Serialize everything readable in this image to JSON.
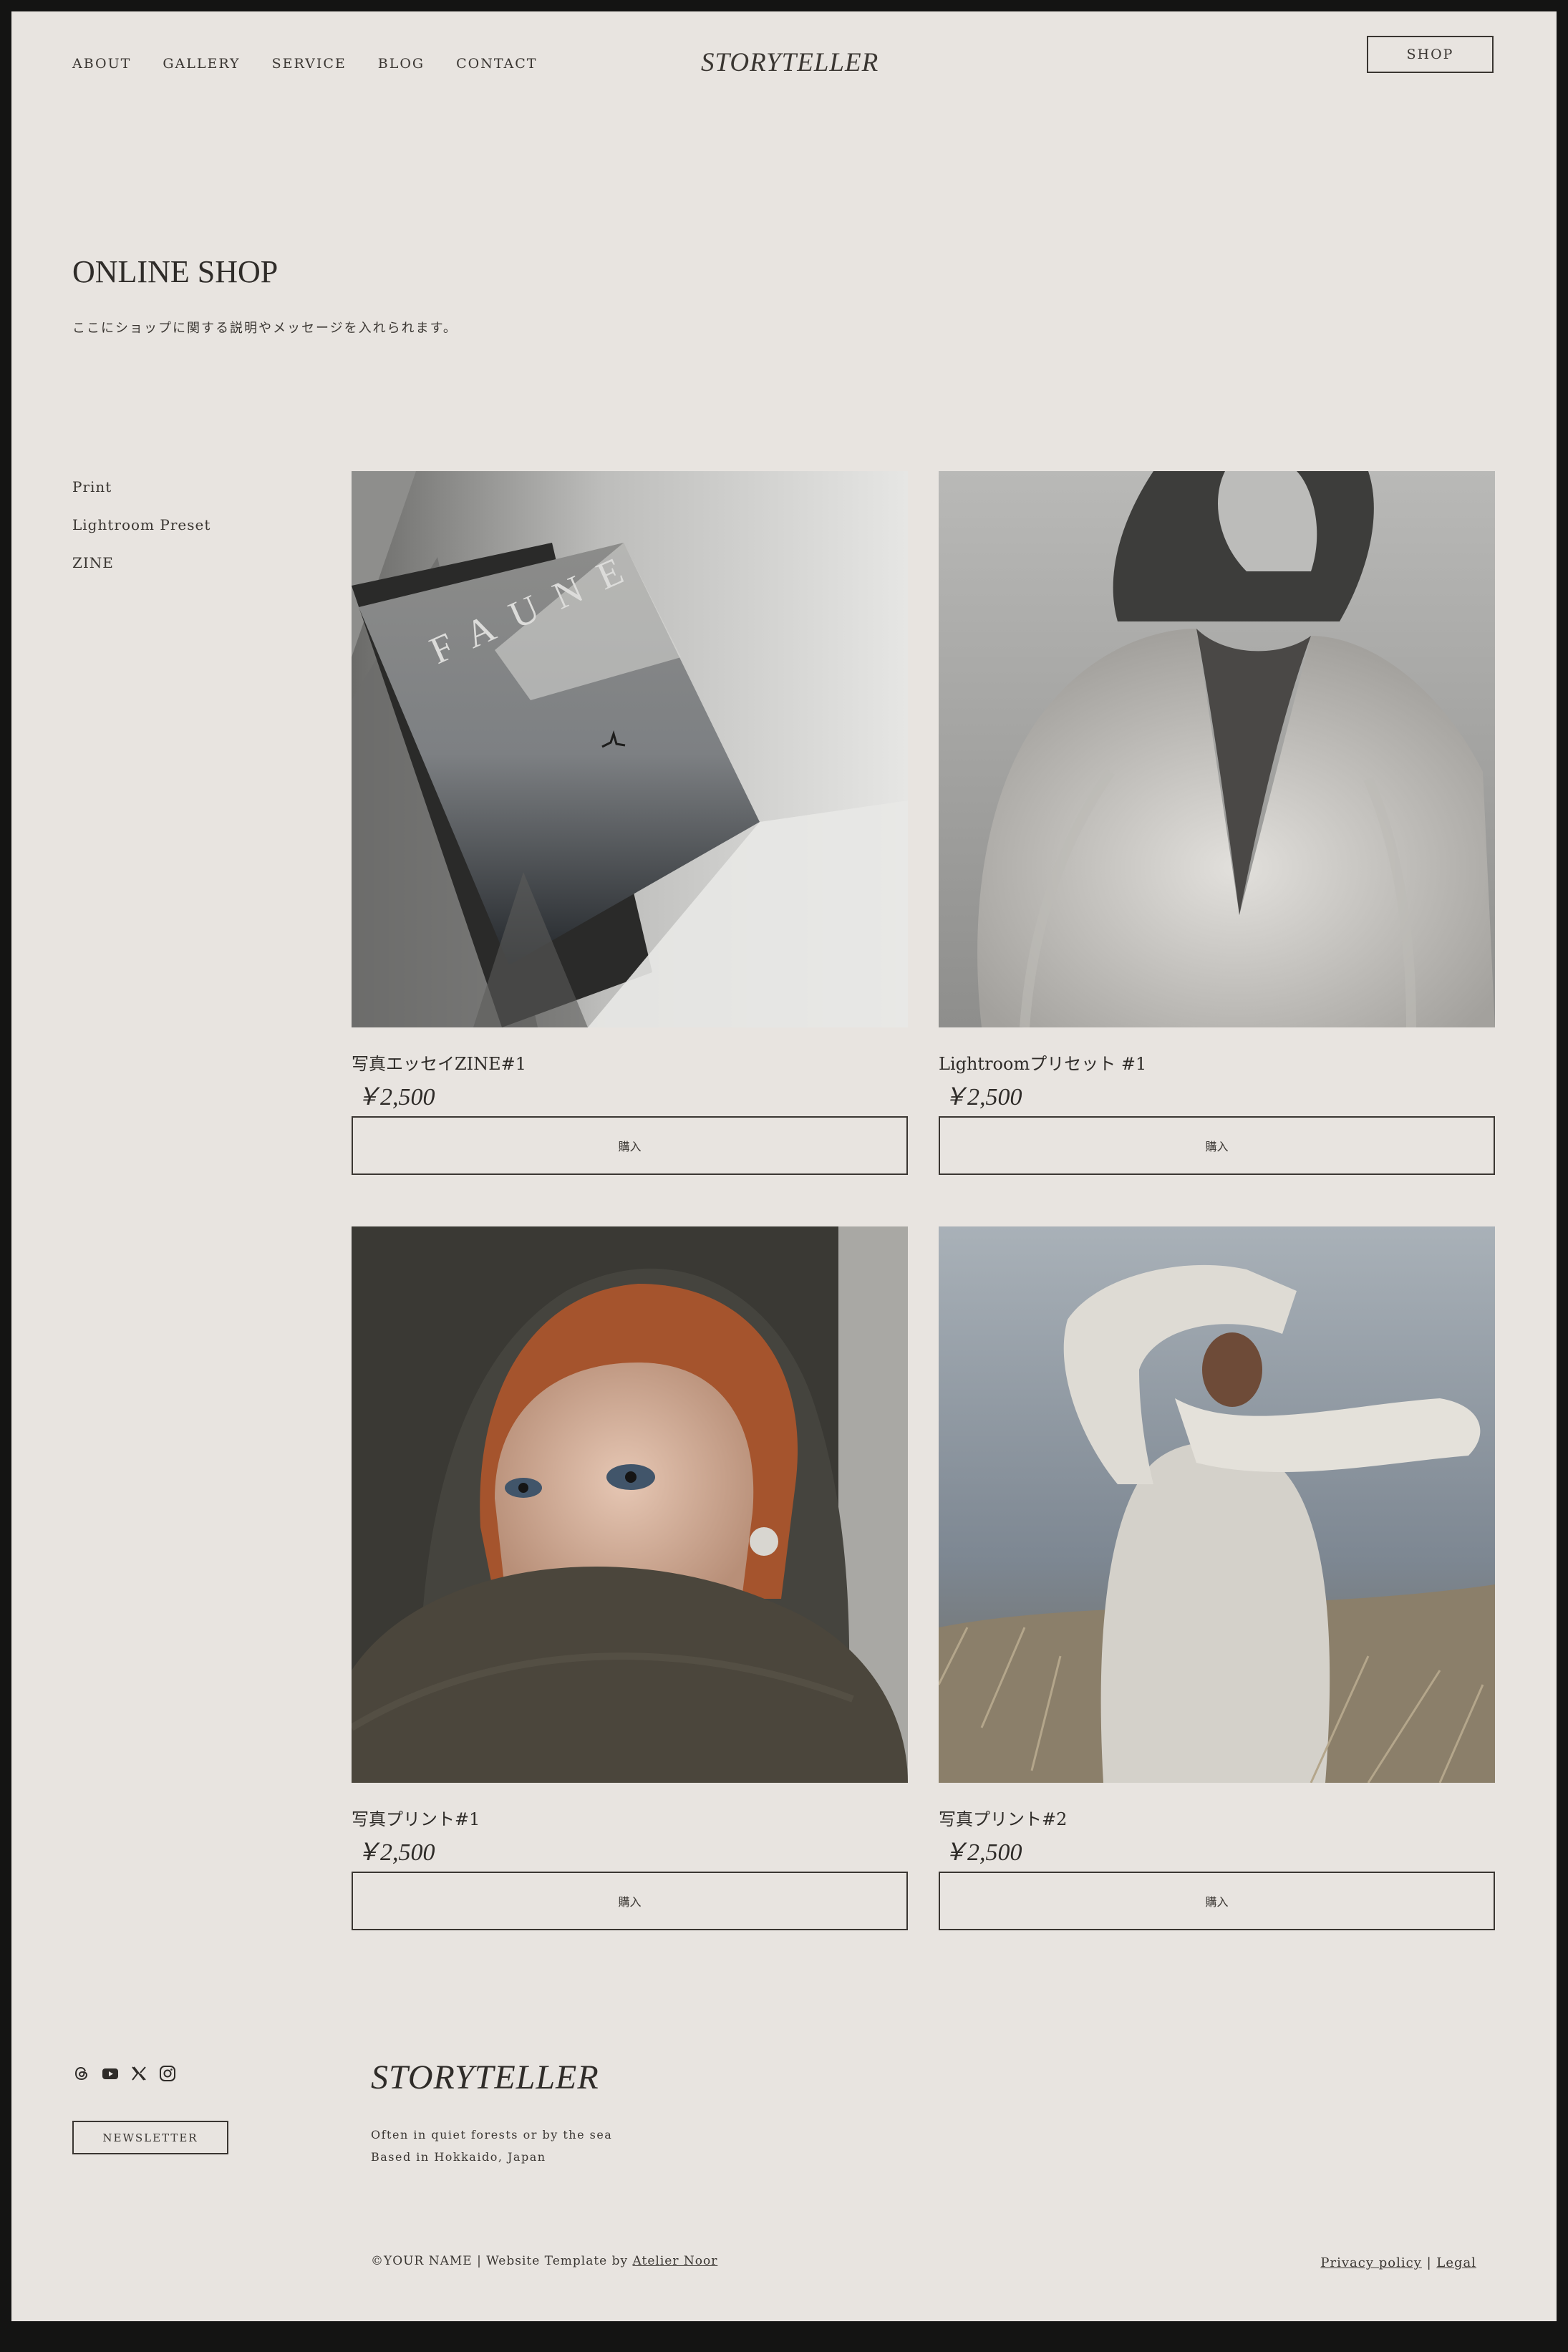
{
  "header": {
    "nav": [
      "ABOUT",
      "GALLERY",
      "SERVICE",
      "BLOG",
      "CONTACT"
    ],
    "logo": "STORYTELLER",
    "shop_label": "SHOP"
  },
  "hero": {
    "title": "ONLINE SHOP",
    "description": "ここにショップに関する説明やメッセージを入れられます。"
  },
  "categories": [
    "Print",
    "Lightroom Preset",
    "ZINE"
  ],
  "products": [
    {
      "name": "写真エッセイZINE#1",
      "price": "￥2,500",
      "button": "購入",
      "image_text": "FAUNE"
    },
    {
      "name": "Lightroomプリセット #1",
      "price": "￥2,500",
      "button": "購入"
    },
    {
      "name": "写真プリント#1",
      "price": "￥2,500",
      "button": "購入"
    },
    {
      "name": "写真プリント#2",
      "price": "￥2,500",
      "button": "購入"
    }
  ],
  "footer": {
    "social_icons": [
      "threads-icon",
      "youtube-icon",
      "x-icon",
      "instagram-icon"
    ],
    "newsletter_label": "NEWSLETTER",
    "logo": "STORYTELLER",
    "tagline_1": "Often in quiet forests or by the sea",
    "tagline_2": "Based in Hokkaido, Japan",
    "copyright": "©YOUR NAME | Website Template by ",
    "credit_link": "Atelier Noor",
    "privacy": "Privacy policy",
    "separator": " | ",
    "legal": "Legal"
  },
  "colors": {
    "page_bg": "#e8e4e0",
    "frame": "#141413",
    "text": "#2f2c29",
    "border": "#3a3632"
  }
}
